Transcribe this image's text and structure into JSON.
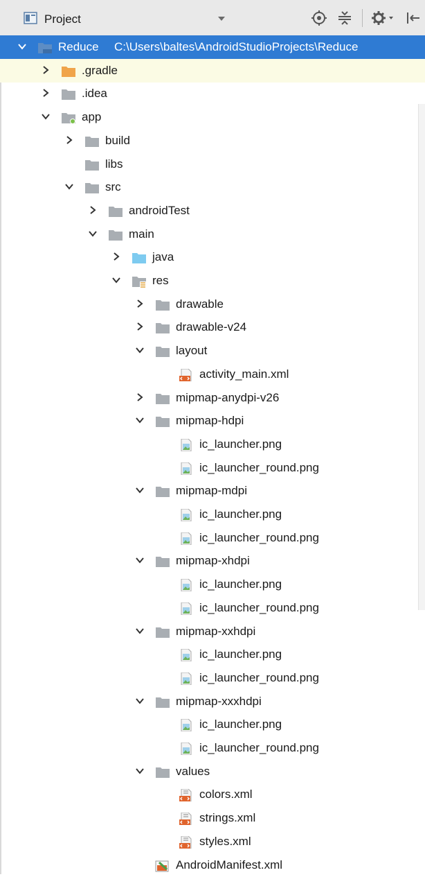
{
  "header": {
    "title": "Project",
    "icons": [
      "project-view-icon",
      "dropdown-arrow-icon",
      "locate-icon",
      "collapse-all-icon",
      "gear-icon",
      "hide-panel-icon"
    ]
  },
  "tree": [
    {
      "label": "Reduce",
      "path": "C:\\Users\\baltes\\AndroidStudioProjects\\Reduce",
      "depth": 0,
      "expanded": true,
      "icon": "project-folder",
      "selected": true
    },
    {
      "label": ".gradle",
      "depth": 1,
      "expanded": false,
      "icon": "folder-orange",
      "highlighted": true
    },
    {
      "label": ".idea",
      "depth": 1,
      "expanded": false,
      "icon": "folder"
    },
    {
      "label": "app",
      "depth": 1,
      "expanded": true,
      "icon": "module-folder"
    },
    {
      "label": "build",
      "depth": 2,
      "expanded": false,
      "icon": "folder"
    },
    {
      "label": "libs",
      "depth": 2,
      "icon": "folder"
    },
    {
      "label": "src",
      "depth": 2,
      "expanded": true,
      "icon": "folder"
    },
    {
      "label": "androidTest",
      "depth": 3,
      "expanded": false,
      "icon": "folder"
    },
    {
      "label": "main",
      "depth": 3,
      "expanded": true,
      "icon": "folder"
    },
    {
      "label": "java",
      "depth": 4,
      "expanded": false,
      "icon": "folder-blue"
    },
    {
      "label": "res",
      "depth": 4,
      "expanded": true,
      "icon": "res-folder"
    },
    {
      "label": "drawable",
      "depth": 5,
      "expanded": false,
      "icon": "folder"
    },
    {
      "label": "drawable-v24",
      "depth": 5,
      "expanded": false,
      "icon": "folder"
    },
    {
      "label": "layout",
      "depth": 5,
      "expanded": true,
      "icon": "folder"
    },
    {
      "label": "activity_main.xml",
      "depth": 6,
      "icon": "xml-file"
    },
    {
      "label": "mipmap-anydpi-v26",
      "depth": 5,
      "expanded": false,
      "icon": "folder"
    },
    {
      "label": "mipmap-hdpi",
      "depth": 5,
      "expanded": true,
      "icon": "folder"
    },
    {
      "label": "ic_launcher.png",
      "depth": 6,
      "icon": "png-file"
    },
    {
      "label": "ic_launcher_round.png",
      "depth": 6,
      "icon": "png-file"
    },
    {
      "label": "mipmap-mdpi",
      "depth": 5,
      "expanded": true,
      "icon": "folder"
    },
    {
      "label": "ic_launcher.png",
      "depth": 6,
      "icon": "png-file"
    },
    {
      "label": "ic_launcher_round.png",
      "depth": 6,
      "icon": "png-file"
    },
    {
      "label": "mipmap-xhdpi",
      "depth": 5,
      "expanded": true,
      "icon": "folder"
    },
    {
      "label": "ic_launcher.png",
      "depth": 6,
      "icon": "png-file"
    },
    {
      "label": "ic_launcher_round.png",
      "depth": 6,
      "icon": "png-file"
    },
    {
      "label": "mipmap-xxhdpi",
      "depth": 5,
      "expanded": true,
      "icon": "folder"
    },
    {
      "label": "ic_launcher.png",
      "depth": 6,
      "icon": "png-file"
    },
    {
      "label": "ic_launcher_round.png",
      "depth": 6,
      "icon": "png-file"
    },
    {
      "label": "mipmap-xxxhdpi",
      "depth": 5,
      "expanded": true,
      "icon": "folder"
    },
    {
      "label": "ic_launcher.png",
      "depth": 6,
      "icon": "png-file"
    },
    {
      "label": "ic_launcher_round.png",
      "depth": 6,
      "icon": "png-file"
    },
    {
      "label": "values",
      "depth": 5,
      "expanded": true,
      "icon": "folder"
    },
    {
      "label": "colors.xml",
      "depth": 6,
      "icon": "values-xml-file"
    },
    {
      "label": "strings.xml",
      "depth": 6,
      "icon": "values-xml-file"
    },
    {
      "label": "styles.xml",
      "depth": 6,
      "icon": "values-xml-file"
    },
    {
      "label": "AndroidManifest.xml",
      "depth": 5,
      "icon": "manifest-file"
    }
  ],
  "colors": {
    "selection": "#2f7bd3",
    "highlight": "#fbfbe4",
    "folder": "#a9aeb3",
    "folder_orange": "#f0a44a",
    "folder_blue": "#7ecbf0",
    "xml_orange": "#e0642d",
    "png_green": "#6cb25a"
  }
}
